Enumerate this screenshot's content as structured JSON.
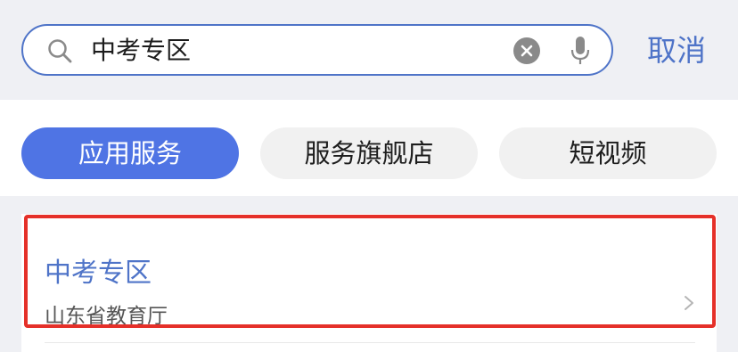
{
  "search": {
    "query": "中考专区",
    "cancel_label": "取消"
  },
  "tabs": [
    {
      "label": "应用服务",
      "active": true
    },
    {
      "label": "服务旗舰店",
      "active": false
    },
    {
      "label": "短视频",
      "active": false
    }
  ],
  "results": [
    {
      "title": "中考专区",
      "subtitle": "山东省教育厅"
    }
  ],
  "colors": {
    "accent": "#4f74e4",
    "link_text": "#4f74c8",
    "highlight": "#e53029",
    "background": "#eff0f4"
  },
  "icons": {
    "search": "search-icon",
    "clear": "clear-icon",
    "mic": "microphone-icon",
    "chevron": "chevron-right-icon"
  }
}
